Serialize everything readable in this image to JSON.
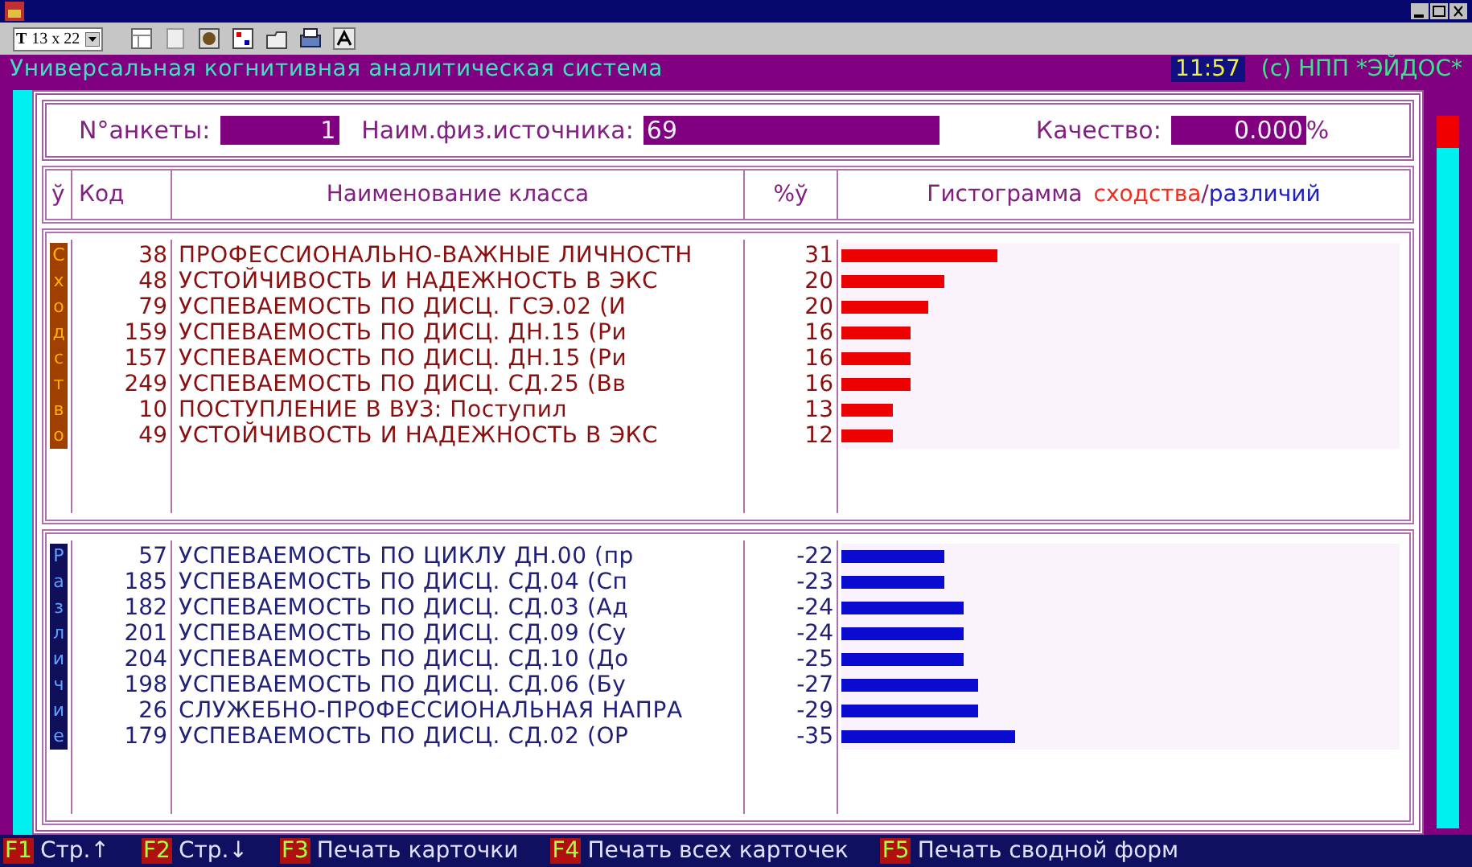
{
  "toolbar": {
    "font_glyph": "T",
    "font_size": "13 x 22"
  },
  "header": {
    "title": "Универсальная когнитивная аналитическая система",
    "time": "11:57",
    "copyright": "(c) НПП *ЭЙДОС*"
  },
  "form": {
    "fields": [
      {
        "label": "N°анкеты:",
        "value": "1"
      },
      {
        "label": "Наим.физ.источника:",
        "value": "69"
      },
      {
        "label": "Качество:",
        "value": "0.000",
        "suffix": "%"
      }
    ]
  },
  "columns": [
    "ў",
    "Код",
    "Наименование класса",
    "%ў"
  ],
  "histogram_heading": {
    "text": "Гистограмма",
    "similar": "сходства",
    "separator": "/",
    "different": "различий"
  },
  "sections": [
    {
      "kind": "similarity",
      "label": "Сходство",
      "rows": [
        {
          "code": "38",
          "name": "ПРОФЕССИОНАЛЬНО-ВАЖНЫЕ ЛИЧНОСТН",
          "percent": "31",
          "level": 0.28
        },
        {
          "code": "48",
          "name": "УСТОЙЧИВОСТЬ И НАДЕЖНОСТЬ В ЭКС",
          "percent": "20",
          "level": 0.185
        },
        {
          "code": "79",
          "name": "УСПЕВАЕМОСТЬ ПО ДИСЦ. ГСЭ.02 (И",
          "percent": "20",
          "level": 0.155
        },
        {
          "code": "159",
          "name": "УСПЕВАЕМОСТЬ ПО ДИСЦ. ДН.15 (Ри",
          "percent": "16",
          "level": 0.123
        },
        {
          "code": "157",
          "name": "УСПЕВАЕМОСТЬ ПО ДИСЦ. ДН.15 (Ри",
          "percent": "16",
          "level": 0.123
        },
        {
          "code": "249",
          "name": "УСПЕВАЕМОСТЬ ПО ДИСЦ. СД.25 (Вв",
          "percent": "16",
          "level": 0.123
        },
        {
          "code": "10",
          "name": "ПОСТУПЛЕНИЕ В ВУЗ: Поступил",
          "percent": "13",
          "level": 0.093
        },
        {
          "code": "49",
          "name": "УСТОЙЧИВОСТЬ И НАДЕЖНОСТЬ В ЭКС",
          "percent": "12",
          "level": 0.093
        }
      ]
    },
    {
      "kind": "difference",
      "label": "Различие",
      "rows": [
        {
          "code": "57",
          "name": "УСПЕВАЕМОСТЬ ПО ЦИКЛУ ДН.00 (пр",
          "percent": "-22",
          "level": 0.185
        },
        {
          "code": "185",
          "name": "УСПЕВАЕМОСТЬ ПО ДИСЦ. СД.04 (Сп",
          "percent": "-23",
          "level": 0.185
        },
        {
          "code": "182",
          "name": "УСПЕВАЕМОСТЬ ПО ДИСЦ. СД.03 (Ад",
          "percent": "-24",
          "level": 0.218
        },
        {
          "code": "201",
          "name": "УСПЕВАЕМОСТЬ ПО ДИСЦ. СД.09 (Су",
          "percent": "-24",
          "level": 0.218
        },
        {
          "code": "204",
          "name": "УСПЕВАЕМОСТЬ ПО ДИСЦ. СД.10 (До",
          "percent": "-25",
          "level": 0.218
        },
        {
          "code": "198",
          "name": "УСПЕВАЕМОСТЬ ПО ДИСЦ. СД.06 (Бу",
          "percent": "-27",
          "level": 0.246
        },
        {
          "code": "26",
          "name": "СЛУЖЕБНО-ПРОФЕССИОНАЛЬНАЯ НАПРА",
          "percent": "-29",
          "level": 0.246
        },
        {
          "code": "179",
          "name": "УСПЕВАЕМОСТЬ ПО ДИСЦ. СД.02 (ОР",
          "percent": "-35",
          "level": 0.31
        }
      ]
    }
  ],
  "function_keys": [
    {
      "key": "F1",
      "label": "Стр.↑"
    },
    {
      "key": "F2",
      "label": "Стр.↓"
    },
    {
      "key": "F3",
      "label": "Печать карточки"
    },
    {
      "key": "F4",
      "label": "Печать всех карточек"
    },
    {
      "key": "F5",
      "label": "Печать сводной форм"
    }
  ]
}
